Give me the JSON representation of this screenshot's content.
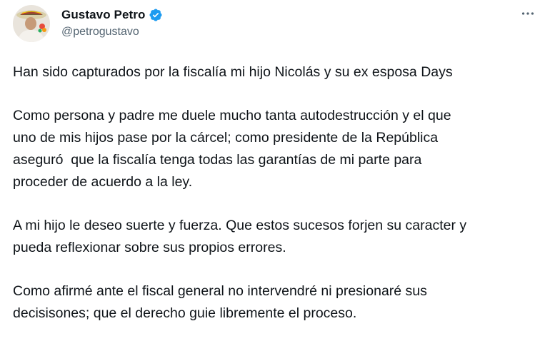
{
  "author": {
    "display_name": "Gustavo Petro",
    "handle": "@petrogustavo",
    "verified": true,
    "avatar_icon": "profile-photo",
    "verified_color": "#1d9bf0"
  },
  "actions": {
    "more_icon": "more-horizontal-icon"
  },
  "tweet": {
    "paragraphs": [
      "Han sido capturados por la fiscalía mi hijo Nicolás y su ex esposa Days",
      "Como persona y padre me duele mucho tanta autodestrucción y el que\nuno de mis hijos pase por la cárcel; como presidente de la República\naseguró  que la fiscalía tenga todas las garantías de mi parte para\nproceder de acuerdo a la ley.",
      "A mi hijo le deseo suerte y fuerza. Que estos sucesos forjen su caracter y\npueda reflexionar sobre sus propios errores.",
      "Como afirmé ante el fiscal general no intervendré ni presionaré sus\ndecisisones; que el derecho guie libremente el proceso."
    ]
  }
}
